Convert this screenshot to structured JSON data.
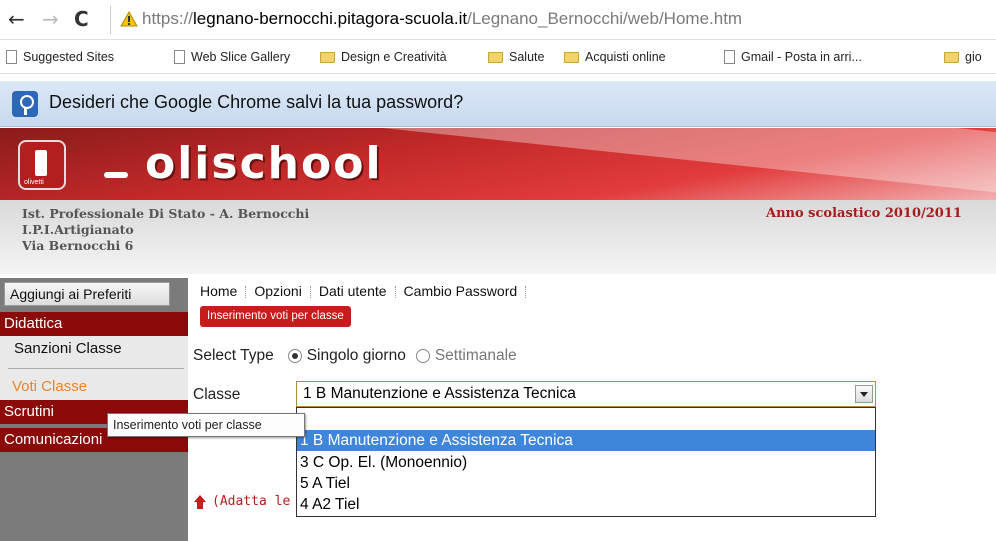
{
  "browser": {
    "url_scheme": "https://",
    "url_host": "legnano-bernocchi.pitagora-scuola.it",
    "url_path": "/Legnano_Bernocchi/web/Home.htm",
    "back_icon": "arrow-left-icon",
    "forward_icon": "arrow-right-icon",
    "reload_icon": "reload-icon"
  },
  "bookmarks": [
    {
      "label": "Suggested Sites",
      "icon": "page-icon"
    },
    {
      "label": "Web Slice Gallery",
      "icon": "page-icon"
    },
    {
      "label": "Design e Creatività",
      "icon": "folder-icon"
    },
    {
      "label": "Salute",
      "icon": "folder-icon"
    },
    {
      "label": "Acquisti online",
      "icon": "folder-icon"
    },
    {
      "label": "Gmail - Posta in arri...",
      "icon": "page-icon"
    },
    {
      "label": "gio",
      "icon": "folder-icon"
    }
  ],
  "infobar": {
    "text": "Desideri che Google Chrome salvi la tua password?"
  },
  "banner": {
    "brand": "olischool",
    "logo_sub": "olivetti"
  },
  "school": {
    "line1": "Ist. Professionale Di Stato - A. Bernocchi",
    "line2": "I.P.I.Artigianato",
    "line3": "Via Bernocchi 6",
    "year": "Anno scolastico 2010/2011"
  },
  "sidebar": {
    "fav_button": "Aggiungi ai Preferiti",
    "didattica": "Didattica",
    "sanzioni": "Sanzioni Classe",
    "voti": "Voti Classe",
    "scrutini": "Scrutini",
    "comunicazioni": "Comunicazioni"
  },
  "topnav": {
    "home": "Home",
    "opzioni": "Opzioni",
    "dati": "Dati utente",
    "cambio": "Cambio Password"
  },
  "tag": "Inserimento voti per classe",
  "form": {
    "select_type_label": "Select Type",
    "radio1": "Singolo giorno",
    "radio2": "Settimanale",
    "classe_label": "Classe",
    "classe_value": "1 B Manutenzione e Assistenza Tecnica",
    "options": [
      "1 B Manutenzione e Assistenza Tecnica",
      "3 C Op. El. (Monoennio)",
      "5 A Tiel",
      "4 A2 Tiel"
    ]
  },
  "tooltip": "Inserimento voti per classe",
  "adapt_text": "(Adatta le"
}
